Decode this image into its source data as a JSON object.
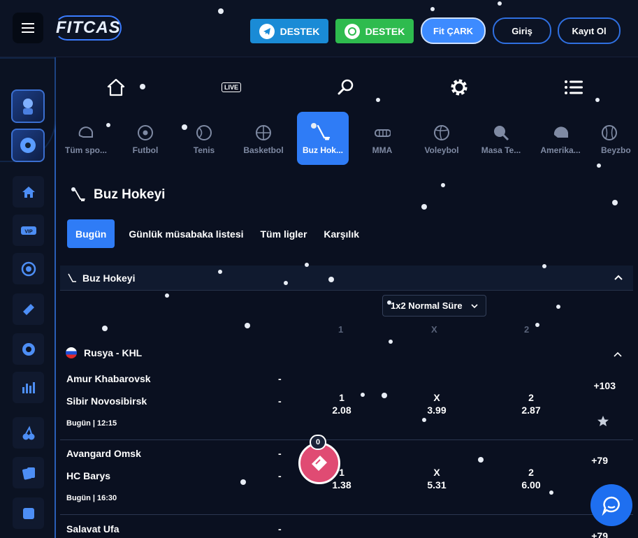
{
  "header": {
    "logo": "FITCAS",
    "telegram_label": "DESTEK",
    "whatsapp_label": "DESTEK",
    "fit_cark_label": "Fit ÇARK",
    "login_label": "Giriş",
    "register_label": "Kayıt Ol"
  },
  "nav": {
    "live_label": "LIVE"
  },
  "sports": [
    {
      "label": "Tüm spo...",
      "icon": "helmet-icon"
    },
    {
      "label": "Futbol",
      "icon": "soccer-ball-icon"
    },
    {
      "label": "Tenis",
      "icon": "tennis-ball-icon"
    },
    {
      "label": "Basketbol",
      "icon": "basketball-icon"
    },
    {
      "label": "Buz Hok...",
      "icon": "hockey-stick-icon"
    },
    {
      "label": "MMA",
      "icon": "mma-glove-icon"
    },
    {
      "label": "Voleybol",
      "icon": "volleyball-icon"
    },
    {
      "label": "Masa Te...",
      "icon": "table-tennis-icon"
    },
    {
      "label": "Amerika...",
      "icon": "football-helmet-icon"
    },
    {
      "label": "Beyzbo",
      "icon": "baseball-icon"
    }
  ],
  "page_title": "Buz Hokeyi",
  "tabs": [
    "Bugün",
    "Günlük müsabaka listesi",
    "Tüm ligler",
    "Karşılık"
  ],
  "section_title": "Buz Hokeyi",
  "market_select": "1x2 Normal Süre",
  "columns": [
    "1",
    "X",
    "2"
  ],
  "league": "Rusya - KHL",
  "matches": [
    {
      "home": "Amur Khabarovsk",
      "away": "Sibir Novosibirsk",
      "home_score": "-",
      "away_score": "-",
      "time": "Bugün | 12:15",
      "odds": [
        {
          "label": "1",
          "value": "2.08"
        },
        {
          "label": "X",
          "value": "3.99"
        },
        {
          "label": "2",
          "value": "2.87"
        }
      ],
      "more": "+103"
    },
    {
      "home": "Avangard Omsk",
      "away": "HC Barys",
      "home_score": "-",
      "away_score": "-",
      "time": "Bugün | 16:30",
      "odds": [
        {
          "label": "1",
          "value": "1.38"
        },
        {
          "label": "X",
          "value": "5.31"
        },
        {
          "label": "2",
          "value": "6.00"
        }
      ],
      "more": "+79"
    },
    {
      "home": "Salavat Ufa",
      "away": "",
      "home_score": "-",
      "away_score": "",
      "time": "",
      "odds": [],
      "more": "+79"
    }
  ],
  "betslip_count": "0",
  "colors": {
    "accent": "#2f7cf6",
    "bg": "#0a1020",
    "telegram": "#1a8bd6",
    "whatsapp": "#2ebb4e",
    "betslip": "#e04b73"
  }
}
